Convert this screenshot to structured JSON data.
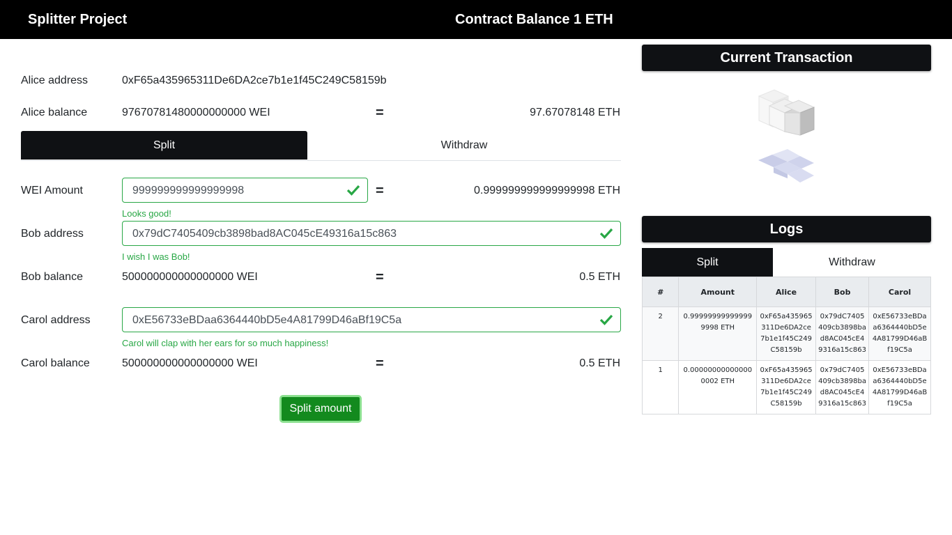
{
  "app": {
    "title": "Splitter Project",
    "contract_balance": "Contract Balance 1 ETH"
  },
  "alice": {
    "address_label": "Alice address",
    "address": "0xF65a435965311De6DA2ce7b1e1f45C249C58159b",
    "balance_label": "Alice balance",
    "balance_wei": "97670781480000000000 WEI",
    "balance_eth": "97.67078148 ETH"
  },
  "equals": "=",
  "tabs": {
    "split": "Split",
    "withdraw": "Withdraw"
  },
  "form": {
    "wei_label": "WEI Amount",
    "wei_value": "999999999999999998",
    "wei_eth": "0.999999999999999998 ETH",
    "wei_hint": "Looks good!",
    "bob_label": "Bob address",
    "bob_value": "0x79dC7405409cb3898bad8AC045cE49316a15c863",
    "bob_hint": "I wish I was Bob!",
    "bob_balance_label": "Bob balance",
    "bob_balance_wei": "500000000000000000 WEI",
    "bob_balance_eth": "0.5 ETH",
    "carol_label": "Carol address",
    "carol_value": "0xE56733eBDaa6364440bD5e4A81799D46aBf19C5a",
    "carol_hint": "Carol will clap with her ears for so much happiness!",
    "carol_balance_label": "Carol balance",
    "carol_balance_wei": "500000000000000000 WEI",
    "carol_balance_eth": "0.5 ETH",
    "submit_label": "Split amount"
  },
  "colors": {
    "valid": "#28a745",
    "dark": "#0f1114",
    "button": "#138a1e"
  },
  "side": {
    "current_tx_title": "Current Transaction",
    "logs_title": "Logs",
    "logs_tabs": {
      "split": "Split",
      "withdraw": "Withdraw"
    },
    "table": {
      "headers": [
        "#",
        "Amount",
        "Alice",
        "Bob",
        "Carol"
      ],
      "rows": [
        [
          "2",
          "0.999999999999999998 ETH",
          "0xF65a435965311De6DA2ce7b1e1f45C249C58159b",
          "0x79dC7405409cb3898bad8AC045cE49316a15c863",
          "0xE56733eBDaa6364440bD5e4A81799D46aBf19C5a"
        ],
        [
          "1",
          "0.000000000000000002 ETH",
          "0xF65a435965311De6DA2ce7b1e1f45C249C58159b",
          "0x79dC7405409cb3898bad8AC045cE49316a15c863",
          "0xE56733eBDaa6364440bD5e4A81799D46aBf19C5a"
        ]
      ]
    }
  }
}
